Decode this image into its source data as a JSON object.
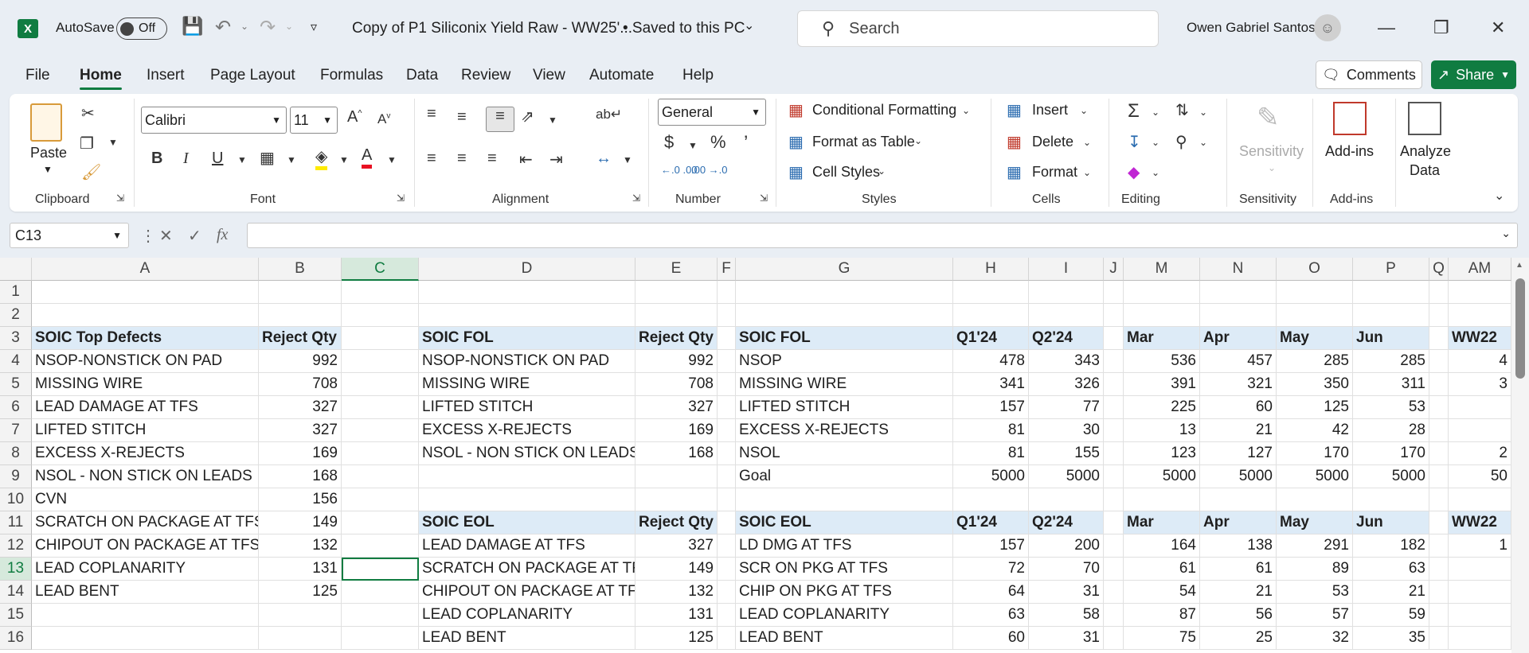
{
  "titlebar": {
    "autosave_label": "AutoSave",
    "autosave_state": "Off",
    "doc_title": "Copy of P1 Siliconix Yield Raw - WW25'...",
    "save_status": "• Saved to this PC",
    "search_placeholder": "Search",
    "user_name": "Owen Gabriel Santos"
  },
  "menu": [
    "File",
    "Home",
    "Insert",
    "Page Layout",
    "Formulas",
    "Data",
    "Review",
    "View",
    "Automate",
    "Help"
  ],
  "actions": {
    "comments": "Comments",
    "share": "Share"
  },
  "ribbon": {
    "paste": "Paste",
    "clipboard": "Clipboard",
    "font_name": "Calibri",
    "font_size": "11",
    "font": "Font",
    "alignment": "Alignment",
    "number_format": "General",
    "number": "Number",
    "conditional_formatting": "Conditional Formatting",
    "format_as_table": "Format as Table",
    "cell_styles": "Cell Styles",
    "styles": "Styles",
    "insert": "Insert",
    "delete": "Delete",
    "format": "Format",
    "cells": "Cells",
    "editing": "Editing",
    "sensitivity_btn": "Sensitivity",
    "sensitivity": "Sensitivity",
    "addins_btn": "Add-ins",
    "addins": "Add-ins",
    "analyze_1": "Analyze",
    "analyze_2": "Data"
  },
  "formula_bar": {
    "name_box": "C13",
    "formula": ""
  },
  "columns": [
    "A",
    "B",
    "C",
    "D",
    "E",
    "F",
    "G",
    "H",
    "I",
    "J",
    "M",
    "N",
    "O",
    "P",
    "Q",
    "AM"
  ],
  "selected_column": "C",
  "selected_row": 13,
  "rows": [
    {
      "n": 1,
      "cells": {}
    },
    {
      "n": 2,
      "cells": {}
    },
    {
      "n": 3,
      "cells": {
        "A": "SOIC Top Defects",
        "B": "Reject Qty",
        "D": "SOIC FOL",
        "E": "Reject Qty",
        "G": "SOIC FOL",
        "H": "Q1'24",
        "I": "Q2'24",
        "M": "Mar",
        "N": "Apr",
        "O": "May",
        "P": "Jun",
        "AM": "WW22"
      }
    },
    {
      "n": 4,
      "cells": {
        "A": "NSOP-NONSTICK ON PAD",
        "B": "992",
        "D": "NSOP-NONSTICK ON PAD",
        "E": "992",
        "G": "NSOP",
        "H": "478",
        "I": "343",
        "M": "536",
        "N": "457",
        "O": "285",
        "P": "285",
        "AM": "4"
      }
    },
    {
      "n": 5,
      "cells": {
        "A": "MISSING WIRE",
        "B": "708",
        "D": "MISSING WIRE",
        "E": "708",
        "G": "MISSING WIRE",
        "H": "341",
        "I": "326",
        "M": "391",
        "N": "321",
        "O": "350",
        "P": "311",
        "AM": "3"
      }
    },
    {
      "n": 6,
      "cells": {
        "A": "LEAD DAMAGE AT TFS",
        "B": "327",
        "D": "LIFTED STITCH",
        "E": "327",
        "G": "LIFTED STITCH",
        "H": "157",
        "I": "77",
        "M": "225",
        "N": "60",
        "O": "125",
        "P": "53"
      }
    },
    {
      "n": 7,
      "cells": {
        "A": "LIFTED STITCH",
        "B": "327",
        "D": "EXCESS X-REJECTS",
        "E": "169",
        "G": "EXCESS X-REJECTS",
        "H": "81",
        "I": "30",
        "M": "13",
        "N": "21",
        "O": "42",
        "P": "28"
      }
    },
    {
      "n": 8,
      "cells": {
        "A": "EXCESS X-REJECTS",
        "B": "169",
        "D": "NSOL - NON STICK ON LEADS",
        "E": "168",
        "G": "NSOL",
        "H": "81",
        "I": "155",
        "M": "123",
        "N": "127",
        "O": "170",
        "P": "170",
        "AM": "2"
      }
    },
    {
      "n": 9,
      "cells": {
        "A": "NSOL - NON STICK ON LEADS",
        "B": "168",
        "G": "Goal",
        "H": "5000",
        "I": "5000",
        "M": "5000",
        "N": "5000",
        "O": "5000",
        "P": "5000",
        "AM": "50"
      }
    },
    {
      "n": 10,
      "cells": {
        "A": "CVN",
        "B": "156"
      }
    },
    {
      "n": 11,
      "cells": {
        "A": "SCRATCH ON PACKAGE AT TFS",
        "B": "149",
        "D": "SOIC EOL",
        "E": "Reject Qty",
        "G": "SOIC EOL",
        "H": "Q1'24",
        "I": "Q2'24",
        "M": "Mar",
        "N": "Apr",
        "O": "May",
        "P": "Jun",
        "AM": "WW22"
      }
    },
    {
      "n": 12,
      "cells": {
        "A": "CHIPOUT ON PACKAGE AT TFS",
        "B": "132",
        "D": "LEAD DAMAGE AT TFS",
        "E": "327",
        "G": "LD DMG AT TFS",
        "H": "157",
        "I": "200",
        "M": "164",
        "N": "138",
        "O": "291",
        "P": "182",
        "AM": "1"
      }
    },
    {
      "n": 13,
      "cells": {
        "A": "LEAD COPLANARITY",
        "B": "131",
        "D": "SCRATCH ON PACKAGE AT TFS",
        "E": "149",
        "G": "SCR ON PKG AT TFS",
        "H": "72",
        "I": "70",
        "M": "61",
        "N": "61",
        "O": "89",
        "P": "63"
      }
    },
    {
      "n": 14,
      "cells": {
        "A": "LEAD BENT",
        "B": "125",
        "D": "CHIPOUT ON PACKAGE AT TFS",
        "E": "132",
        "G": "CHIP ON PKG AT TFS",
        "H": "64",
        "I": "31",
        "M": "54",
        "N": "21",
        "O": "53",
        "P": "21"
      }
    },
    {
      "n": 15,
      "cells": {
        "D": "LEAD COPLANARITY",
        "E": "131",
        "G": "LEAD COPLANARITY",
        "H": "63",
        "I": "58",
        "M": "87",
        "N": "56",
        "O": "57",
        "P": "59"
      }
    },
    {
      "n": 16,
      "cells": {
        "D": "LEAD BENT",
        "E": "125",
        "G": "LEAD BENT",
        "H": "60",
        "I": "31",
        "M": "75",
        "N": "25",
        "O": "32",
        "P": "35"
      }
    }
  ],
  "header_rows": [
    3,
    11
  ],
  "header_cols": {
    "3": [
      "A",
      "B",
      "D",
      "E",
      "G",
      "H",
      "I",
      "M",
      "N",
      "O",
      "P",
      "AM"
    ],
    "11": [
      "D",
      "E",
      "G",
      "H",
      "I",
      "M",
      "N",
      "O",
      "P",
      "AM"
    ]
  }
}
